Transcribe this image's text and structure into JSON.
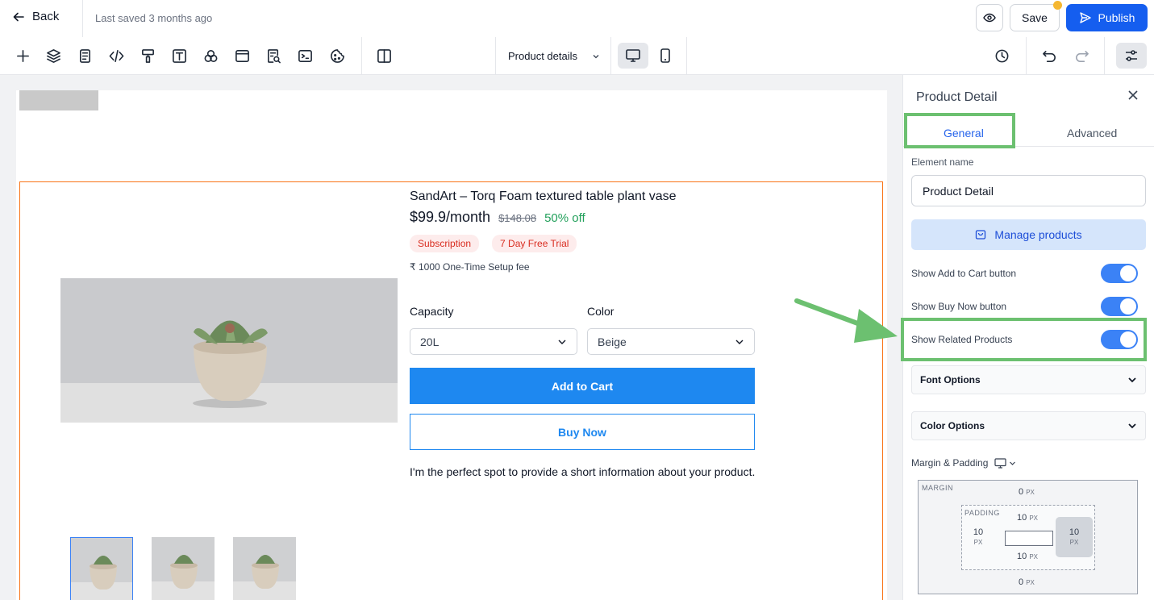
{
  "header": {
    "back_label": "Back",
    "last_saved": "Last saved 3 months ago",
    "save_label": "Save",
    "publish_label": "Publish"
  },
  "toolbar": {
    "tools": [
      "add-icon",
      "layers-icon",
      "pages-icon",
      "code-icon",
      "paint-roller-icon",
      "text-icon",
      "elements-icon",
      "section-icon",
      "seo-search-icon",
      "terminal-icon",
      "cookie-icon",
      "split-view-icon"
    ],
    "page_select": "Product details",
    "devices": [
      "desktop-icon",
      "mobile-icon"
    ]
  },
  "product": {
    "title": "SandArt – Torq Foam textured table plant vase",
    "price": "$99.9/month",
    "old_price": "$148.08",
    "discount": "50% off",
    "badges": [
      "Subscription",
      "7 Day Free Trial"
    ],
    "setup_fee": "₹ 1000 One-Time Setup fee",
    "capacity_label": "Capacity",
    "capacity_value": "20L",
    "color_label": "Color",
    "color_value": "Beige",
    "add_to_cart": "Add to Cart",
    "buy_now": "Buy Now",
    "description": "I'm the perfect spot to provide a short information about your product."
  },
  "panel": {
    "title": "Product Detail",
    "tabs": {
      "general": "General",
      "advanced": "Advanced"
    },
    "element_name_label": "Element name",
    "element_name_value": "Product Detail",
    "manage_products": "Manage products",
    "toggles": [
      {
        "label": "Show Add to Cart button",
        "on": true
      },
      {
        "label": "Show Buy Now button",
        "on": true
      },
      {
        "label": "Show Related Products",
        "on": true
      }
    ],
    "font_options": "Font Options",
    "color_options": "Color Options",
    "margin_padding_label": "Margin & Padding",
    "spacing": {
      "margin_label": "MARGIN",
      "padding_label": "PADDING",
      "margin_top": "0",
      "margin_bottom": "0",
      "padding_top": "10",
      "padding_bottom": "10",
      "padding_left": "10",
      "padding_right": "10",
      "unit": "PX"
    }
  },
  "colors": {
    "accent": "#155eef",
    "button_blue": "#1e88f0",
    "selection_outline": "#f97316",
    "annotation_green": "#6cc070",
    "discount_green": "#22a05b",
    "badge_red": "#d92d20"
  }
}
